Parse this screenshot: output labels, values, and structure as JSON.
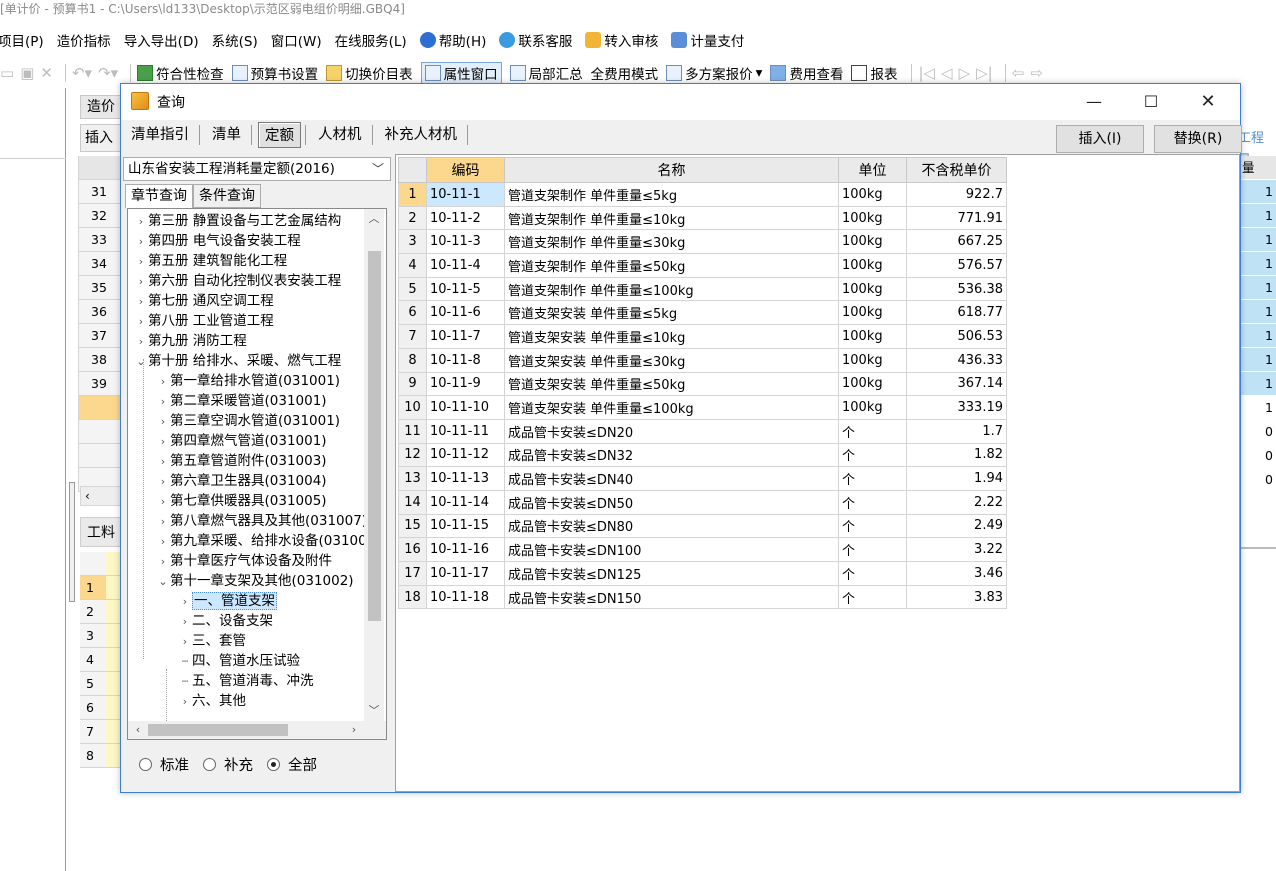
{
  "app": {
    "title": "[单计价 - 预算书1 - C:\\Users\\ld133\\Desktop\\示范区弱电组价明细.GBQ4]"
  },
  "menubar": {
    "items": [
      {
        "label": "项目(P)"
      },
      {
        "label": "造价指标"
      },
      {
        "label": "导入导出(D)"
      },
      {
        "label": "系统(S)"
      },
      {
        "label": "窗口(W)"
      },
      {
        "label": "在线服务(L)"
      },
      {
        "label": "帮助(H)",
        "icon": "help-icon"
      },
      {
        "label": "联系客服",
        "icon": "support-icon"
      },
      {
        "label": "转入审核",
        "icon": "review-icon"
      },
      {
        "label": "计量支付",
        "icon": "payment-icon"
      }
    ]
  },
  "toolbar": {
    "items": [
      {
        "label": "符合性检查"
      },
      {
        "label": "预算书设置"
      },
      {
        "label": "切换价目表"
      },
      {
        "label": "属性窗口"
      },
      {
        "label": "局部汇总"
      },
      {
        "label": "全费用模式"
      },
      {
        "label": "多方案报价"
      },
      {
        "label": "费用查看"
      },
      {
        "label": "报表"
      }
    ]
  },
  "background": {
    "tab_label": "造价",
    "insert_label": "插入",
    "row_numbers": [
      "31",
      "32",
      "33",
      "34",
      "35",
      "36",
      "37",
      "38",
      "39"
    ],
    "lower_tab": "工料机",
    "lower_rows": [
      "1",
      "2",
      "3",
      "4",
      "5",
      "6",
      "7",
      "8"
    ],
    "right_header": "工程量",
    "right_col_header": "量",
    "right_values": [
      "1",
      "1",
      "1",
      "1",
      "1",
      "1",
      "1",
      "1",
      "1",
      "1",
      "0",
      "0",
      "0"
    ]
  },
  "dialog": {
    "title": "查询",
    "tabs": [
      "清单指引",
      "清单",
      "定额",
      "人材机",
      "补充人材机"
    ],
    "active_tab": "定额",
    "insert_button": "插入(I)",
    "replace_button": "替换(R)",
    "quota_library": "山东省安装工程消耗量定额(2016)",
    "subtabs": [
      "章节查询",
      "条件查询"
    ],
    "tree": [
      {
        "label": "第三册 静置设备与工艺金属结构",
        "level": 0,
        "arrow": "›"
      },
      {
        "label": "第四册 电气设备安装工程",
        "level": 0,
        "arrow": "›"
      },
      {
        "label": "第五册 建筑智能化工程",
        "level": 0,
        "arrow": "›"
      },
      {
        "label": "第六册 自动化控制仪表安装工程",
        "level": 0,
        "arrow": "›"
      },
      {
        "label": "第七册 通风空调工程",
        "level": 0,
        "arrow": "›"
      },
      {
        "label": "第八册 工业管道工程",
        "level": 0,
        "arrow": "›"
      },
      {
        "label": "第九册 消防工程",
        "level": 0,
        "arrow": "›"
      },
      {
        "label": "第十册 给排水、采暖、燃气工程",
        "level": 0,
        "arrow": "⌄"
      },
      {
        "label": "第一章给排水管道(031001)",
        "level": 1,
        "arrow": "›"
      },
      {
        "label": "第二章采暖管道(031001)",
        "level": 1,
        "arrow": "›"
      },
      {
        "label": "第三章空调水管道(031001)",
        "level": 1,
        "arrow": "›"
      },
      {
        "label": "第四章燃气管道(031001)",
        "level": 1,
        "arrow": "›"
      },
      {
        "label": "第五章管道附件(031003)",
        "level": 1,
        "arrow": "›"
      },
      {
        "label": "第六章卫生器具(031004)",
        "level": 1,
        "arrow": "›"
      },
      {
        "label": "第七章供暖器具(031005)",
        "level": 1,
        "arrow": "›"
      },
      {
        "label": "第八章燃气器具及其他(031007)",
        "level": 1,
        "arrow": "›"
      },
      {
        "label": "第九章采暖、给排水设备(031006)",
        "level": 1,
        "arrow": "›"
      },
      {
        "label": "第十章医疗气体设备及附件",
        "level": 1,
        "arrow": "›"
      },
      {
        "label": "第十一章支架及其他(031002)",
        "level": 1,
        "arrow": "⌄"
      },
      {
        "label": "一、管道支架",
        "level": 2,
        "arrow": "›",
        "selected": true
      },
      {
        "label": "二、设备支架",
        "level": 2,
        "arrow": "›"
      },
      {
        "label": "三、套管",
        "level": 2,
        "arrow": "›"
      },
      {
        "label": "四、管道水压试验",
        "level": 2,
        "arrow": ""
      },
      {
        "label": "五、管道消毒、冲洗",
        "level": 2,
        "arrow": ""
      },
      {
        "label": "六、其他",
        "level": 2,
        "arrow": "›"
      }
    ],
    "radio_options": [
      {
        "label": "标准",
        "checked": false
      },
      {
        "label": "补充",
        "checked": false
      },
      {
        "label": "全部",
        "checked": true
      }
    ],
    "grid": {
      "headers": [
        "编码",
        "名称",
        "单位",
        "不含税单价"
      ],
      "rows": [
        {
          "no": "1",
          "code": "10-11-1",
          "name": "管道支架制作 单件重量≤5kg",
          "unit": "100kg",
          "price": "922.7"
        },
        {
          "no": "2",
          "code": "10-11-2",
          "name": "管道支架制作 单件重量≤10kg",
          "unit": "100kg",
          "price": "771.91"
        },
        {
          "no": "3",
          "code": "10-11-3",
          "name": "管道支架制作 单件重量≤30kg",
          "unit": "100kg",
          "price": "667.25"
        },
        {
          "no": "4",
          "code": "10-11-4",
          "name": "管道支架制作 单件重量≤50kg",
          "unit": "100kg",
          "price": "576.57"
        },
        {
          "no": "5",
          "code": "10-11-5",
          "name": "管道支架制作 单件重量≤100kg",
          "unit": "100kg",
          "price": "536.38"
        },
        {
          "no": "6",
          "code": "10-11-6",
          "name": "管道支架安装 单件重量≤5kg",
          "unit": "100kg",
          "price": "618.77"
        },
        {
          "no": "7",
          "code": "10-11-7",
          "name": "管道支架安装 单件重量≤10kg",
          "unit": "100kg",
          "price": "506.53"
        },
        {
          "no": "8",
          "code": "10-11-8",
          "name": "管道支架安装 单件重量≤30kg",
          "unit": "100kg",
          "price": "436.33"
        },
        {
          "no": "9",
          "code": "10-11-9",
          "name": "管道支架安装 单件重量≤50kg",
          "unit": "100kg",
          "price": "367.14"
        },
        {
          "no": "10",
          "code": "10-11-10",
          "name": "管道支架安装 单件重量≤100kg",
          "unit": "100kg",
          "price": "333.19"
        },
        {
          "no": "11",
          "code": "10-11-11",
          "name": "成品管卡安装≤DN20",
          "unit": "个",
          "price": "1.7"
        },
        {
          "no": "12",
          "code": "10-11-12",
          "name": "成品管卡安装≤DN32",
          "unit": "个",
          "price": "1.82"
        },
        {
          "no": "13",
          "code": "10-11-13",
          "name": "成品管卡安装≤DN40",
          "unit": "个",
          "price": "1.94"
        },
        {
          "no": "14",
          "code": "10-11-14",
          "name": "成品管卡安装≤DN50",
          "unit": "个",
          "price": "2.22"
        },
        {
          "no": "15",
          "code": "10-11-15",
          "name": "成品管卡安装≤DN80",
          "unit": "个",
          "price": "2.49"
        },
        {
          "no": "16",
          "code": "10-11-16",
          "name": "成品管卡安装≤DN100",
          "unit": "个",
          "price": "3.22"
        },
        {
          "no": "17",
          "code": "10-11-17",
          "name": "成品管卡安装≤DN125",
          "unit": "个",
          "price": "3.46"
        },
        {
          "no": "18",
          "code": "10-11-18",
          "name": "成品管卡安装≤DN150",
          "unit": "个",
          "price": "3.83"
        }
      ]
    }
  }
}
